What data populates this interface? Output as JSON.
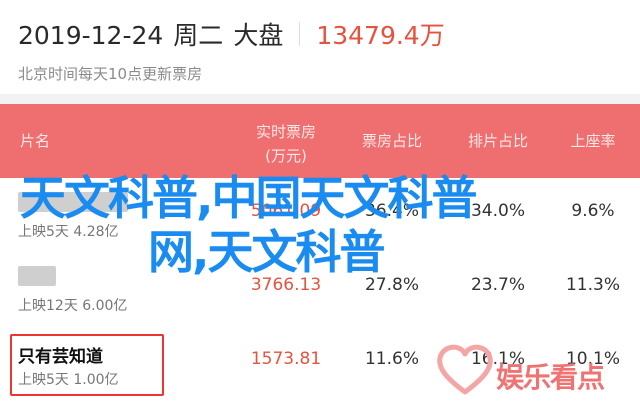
{
  "header": {
    "date": "2019-12-24",
    "weekday": "周二",
    "market_label": "大盘",
    "total": "13479.4万",
    "subline": "北京时间每天10点更新票房"
  },
  "table": {
    "columns": {
      "name": "片名",
      "box_line1": "实时票房",
      "box_line2": "(万元)",
      "share": "票房占比",
      "schedule": "排片占比",
      "seat": "上座率"
    },
    "rows": [
      {
        "title": "",
        "meta": "上映5天 4.28亿",
        "box": "5061.09",
        "share": "36.4%",
        "schedule": "34.0%",
        "seat": "9.6%",
        "accent": "#e5533f"
      },
      {
        "title": "",
        "meta": "上映12天 6.00亿",
        "box": "3766.13",
        "share": "27.8%",
        "schedule": "23.7%",
        "seat": "11.3%",
        "accent": "#e5533f"
      },
      {
        "title": "只有芸知道",
        "meta": "上映5天 1.00亿",
        "box": "1573.81",
        "share": "11.6%",
        "schedule": "16.1%",
        "seat": "10.1%",
        "accent": "#e5533f"
      }
    ]
  },
  "overlay": {
    "line1": "天文科普,中国天文科普",
    "line2": "网,天文科普",
    "color": "#1a8bf0"
  },
  "watermark": {
    "text": "娱乐看点",
    "color": "#f07373"
  }
}
